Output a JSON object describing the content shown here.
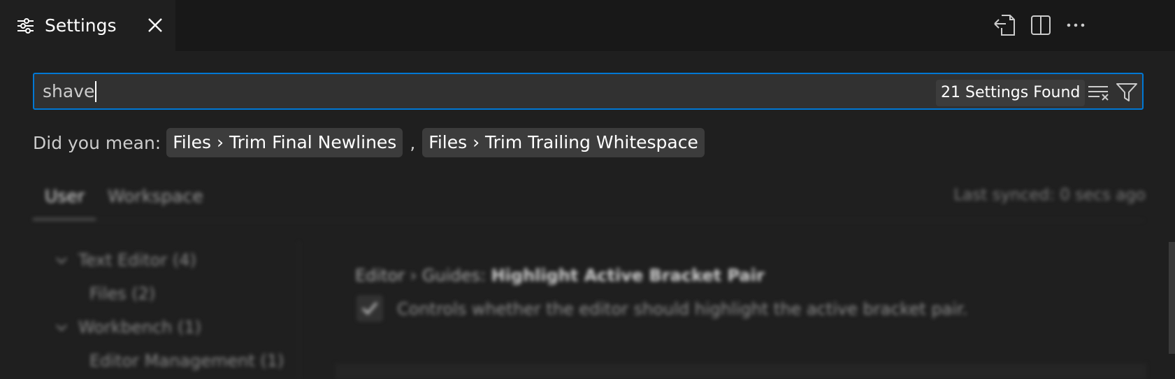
{
  "tab": {
    "label": "Settings",
    "icon": "settings-sliders-icon",
    "close_icon": "close-icon"
  },
  "editor_actions": [
    {
      "name": "open-settings-json-icon"
    },
    {
      "name": "split-editor-icon"
    },
    {
      "name": "more-actions-icon"
    }
  ],
  "search": {
    "value": "shave",
    "result_count": "21 Settings Found",
    "clear_icon": "clear-filter-icon",
    "filter_icon": "filter-icon"
  },
  "did_you_mean": {
    "prefix": "Did you mean:",
    "separator": ",",
    "suggestions": [
      "Files › Trim Final Newlines",
      "Files › Trim Trailing Whitespace"
    ]
  },
  "scope": {
    "tabs": [
      "User",
      "Workspace"
    ],
    "active": "User",
    "sync_status": "Last synced: 0 secs ago"
  },
  "toc": [
    {
      "label": "Text Editor (4)",
      "expanded": true
    },
    {
      "label": "Files (2)"
    },
    {
      "label": "Workbench (1)",
      "expanded": true
    },
    {
      "label": "Editor Management (1)"
    }
  ],
  "setting": {
    "category": "Editor › Guides:",
    "name": "Highlight Active Bracket Pair",
    "description": "Controls whether the editor should highlight the active bracket pair.",
    "checked": true
  },
  "colors": {
    "accent": "#0078d4",
    "background": "#1f1f1f",
    "tabbar": "#181818",
    "pill": "#3c3c3c"
  }
}
